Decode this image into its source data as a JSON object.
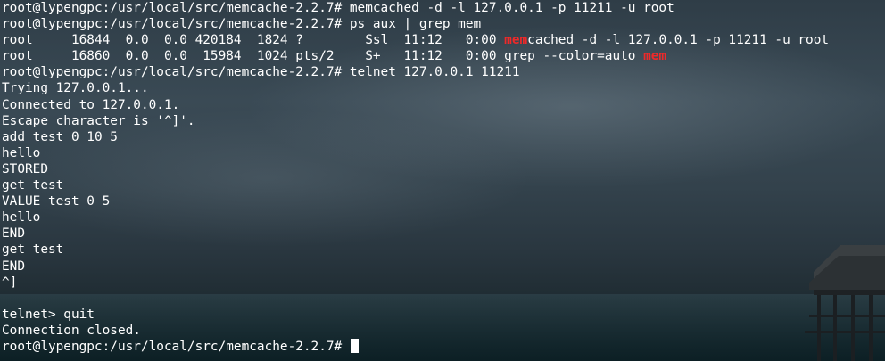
{
  "terminal": {
    "lines": [
      {
        "text": "root@lypengpc:/usr/local/src/memcache-2.2.7# memcached -d -l 127.0.0.1 -p 11211 -u root"
      },
      {
        "text": "root@lypengpc:/usr/local/src/memcache-2.2.7# ps aux | grep mem"
      },
      {
        "before": "root     16844  0.0  0.0 420184  1824 ?        Ssl  11:12   0:00 ",
        "match": "mem",
        "after": "cached -d -l 127.0.0.1 -p 11211 -u root"
      },
      {
        "before": "root     16860  0.0  0.0  15984  1024 pts/2    S+   11:12   0:00 grep --color=auto ",
        "match": "mem",
        "after": ""
      },
      {
        "text": "root@lypengpc:/usr/local/src/memcache-2.2.7# telnet 127.0.0.1 11211"
      },
      {
        "text": "Trying 127.0.0.1..."
      },
      {
        "text": "Connected to 127.0.0.1."
      },
      {
        "text": "Escape character is '^]'."
      },
      {
        "text": "add test 0 10 5"
      },
      {
        "text": "hello"
      },
      {
        "text": "STORED"
      },
      {
        "text": "get test"
      },
      {
        "text": "VALUE test 0 5"
      },
      {
        "text": "hello"
      },
      {
        "text": "END"
      },
      {
        "text": "get test"
      },
      {
        "text": "END"
      },
      {
        "text": "^]"
      },
      {
        "text": ""
      },
      {
        "text": "telnet> quit"
      },
      {
        "text": "Connection closed."
      }
    ],
    "prompt": "root@lypengpc:/usr/local/src/memcache-2.2.7# "
  },
  "colors": {
    "text": "#ffffff",
    "grep_match": "#ef2929"
  },
  "icons": {
    "cursor": "block-cursor"
  }
}
